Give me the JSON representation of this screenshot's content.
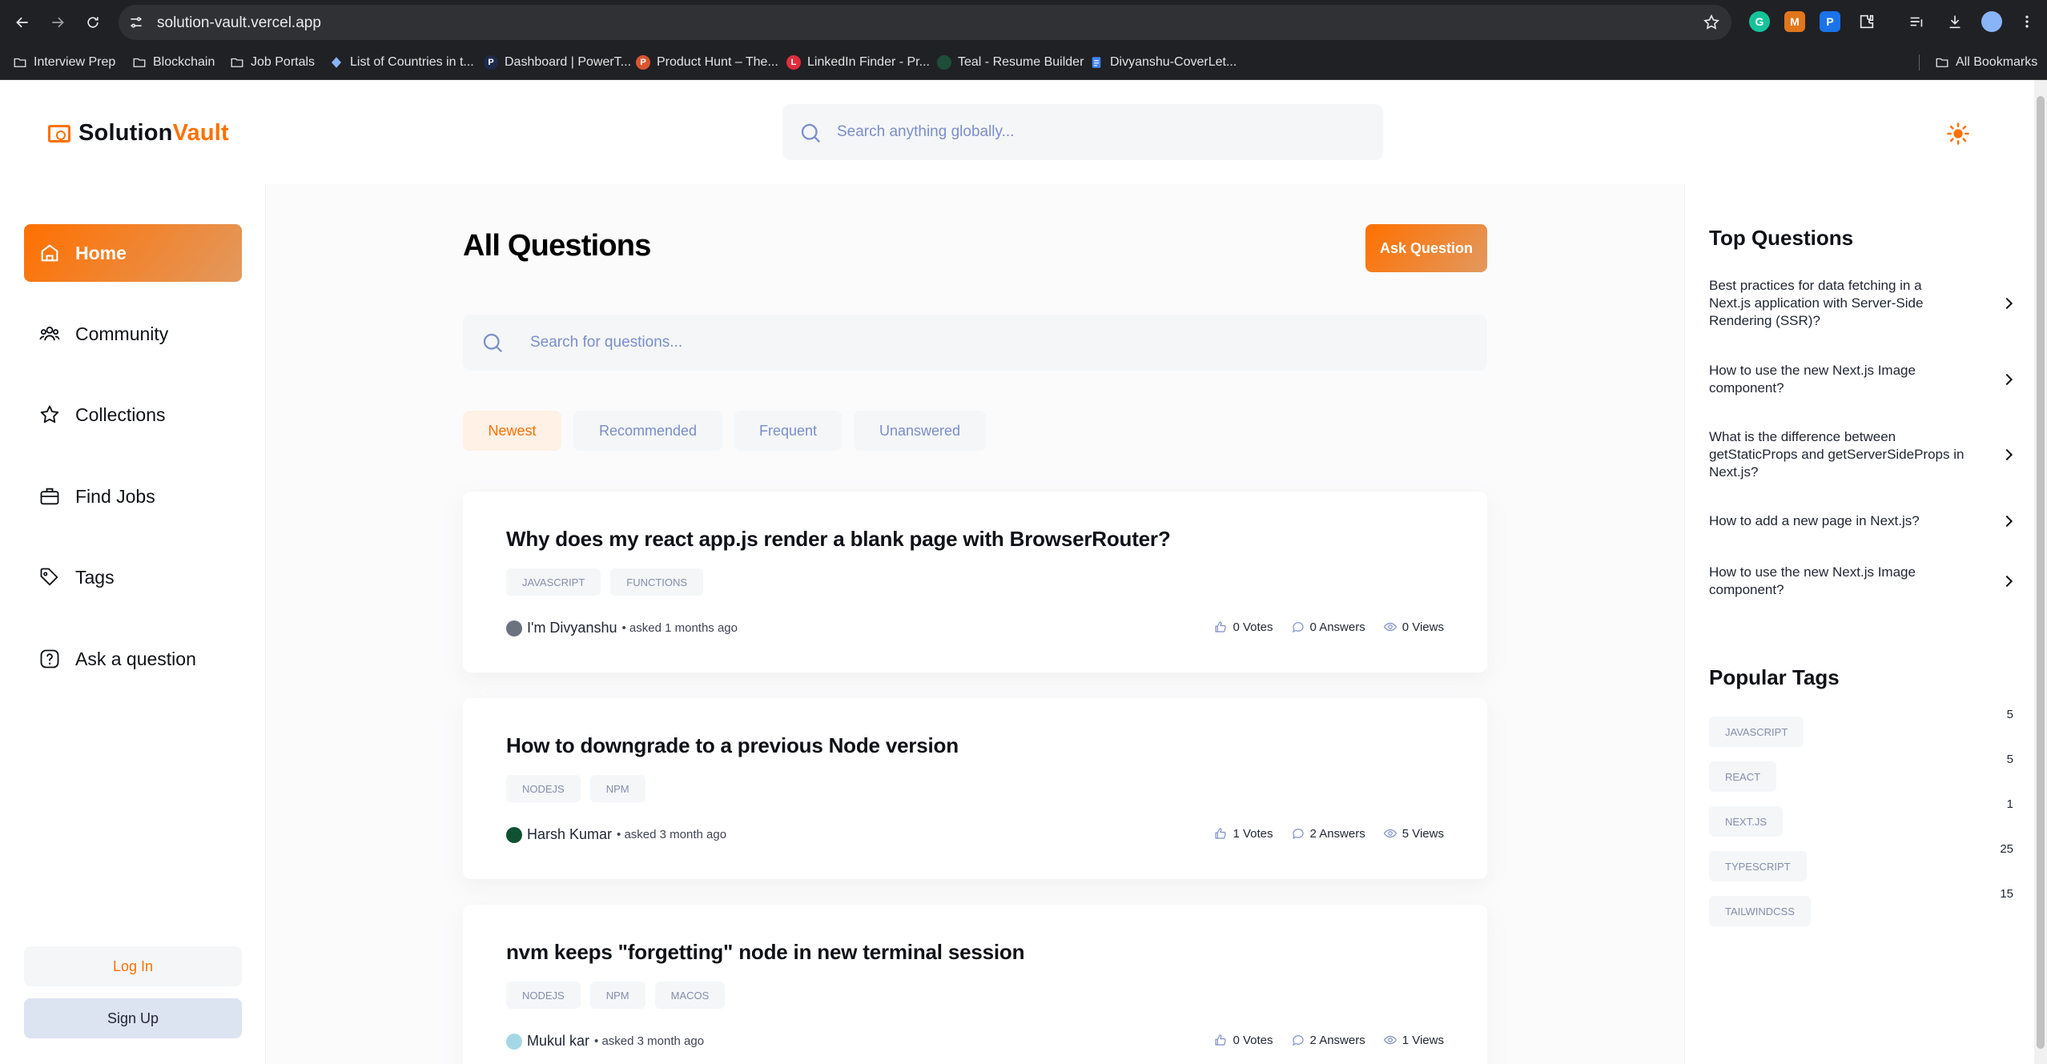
{
  "browser": {
    "url": "solution-vault.vercel.app",
    "bookmarks": [
      {
        "label": "Interview Prep",
        "icon": "folder-icon"
      },
      {
        "label": "Blockchain",
        "icon": "folder-icon"
      },
      {
        "label": "Job Portals",
        "icon": "folder-icon"
      },
      {
        "label": "List of Countries in t...",
        "icon": "globe-icon"
      },
      {
        "label": "Dashboard | PowerT...",
        "icon": "p-icon"
      },
      {
        "label": "Product Hunt – The...",
        "icon": "product-hunt-icon"
      },
      {
        "label": "LinkedIn Finder - Pr...",
        "icon": "linkedin-finder-icon"
      },
      {
        "label": "Teal - Resume Builder",
        "icon": "teal-icon"
      },
      {
        "label": "Divyanshu-CoverLet...",
        "icon": "docs-icon"
      }
    ],
    "all_bookmarks": "All Bookmarks"
  },
  "header": {
    "logo_prefix": "Solution",
    "logo_suffix": "Vault",
    "search_placeholder": "Search anything globally..."
  },
  "sidebar": {
    "items": [
      {
        "label": "Home",
        "icon": "home-icon",
        "active": true
      },
      {
        "label": "Community",
        "icon": "users-icon"
      },
      {
        "label": "Collections",
        "icon": "star-icon"
      },
      {
        "label": "Find Jobs",
        "icon": "suitcase-icon"
      },
      {
        "label": "Tags",
        "icon": "tag-icon"
      },
      {
        "label": "Ask a question",
        "icon": "question-icon"
      }
    ],
    "login_label": "Log In",
    "signup_label": "Sign Up"
  },
  "main": {
    "title": "All Questions",
    "ask_button": "Ask Question",
    "search_placeholder": "Search for questions...",
    "filters": [
      {
        "label": "Newest",
        "active": true
      },
      {
        "label": "Recommended"
      },
      {
        "label": "Frequent"
      },
      {
        "label": "Unanswered"
      }
    ],
    "questions": [
      {
        "title": "Why does my react app.js render a blank page with BrowserRouter?",
        "tags": [
          "JAVASCRIPT",
          "FUNCTIONS"
        ],
        "author": "I'm Divyanshu",
        "asked": "• asked 1 months ago",
        "votes": "0 Votes",
        "answers": "0 Answers",
        "views": "0 Views"
      },
      {
        "title": "How to downgrade to a previous Node version",
        "tags": [
          "NODEJS",
          "NPM"
        ],
        "author": "Harsh Kumar",
        "asked": "• asked 3 month ago",
        "votes": "1 Votes",
        "answers": "2 Answers",
        "views": "5 Views"
      },
      {
        "title": "nvm keeps \"forgetting\" node in new terminal session",
        "tags": [
          "NODEJS",
          "NPM",
          "MACOS"
        ],
        "author": "Mukul kar",
        "asked": "• asked 3 month ago",
        "votes": "0 Votes",
        "answers": "2 Answers",
        "views": "1 Views"
      }
    ]
  },
  "right_sidebar": {
    "top_questions_title": "Top Questions",
    "top_questions": [
      "Best practices for data fetching in a Next.js application with Server-Side Rendering (SSR)?",
      "How to use the new Next.js Image component?",
      "What is the difference between getStaticProps and getServerSideProps in Next.js?",
      "How to add a new page in Next.js?",
      "How to use the new Next.js Image component?"
    ],
    "popular_tags_title": "Popular Tags",
    "popular_tags": [
      {
        "name": "JAVASCRIPT",
        "count": "5"
      },
      {
        "name": "REACT",
        "count": "5"
      },
      {
        "name": "NEXT.JS",
        "count": "1"
      },
      {
        "name": "TYPESCRIPT",
        "count": "25"
      },
      {
        "name": "TAILWINDCSS",
        "count": "15"
      }
    ]
  },
  "colors": {
    "accent": "#ff7000",
    "accent_light": "#fff1e6",
    "muted_text": "#7b8ec8"
  }
}
